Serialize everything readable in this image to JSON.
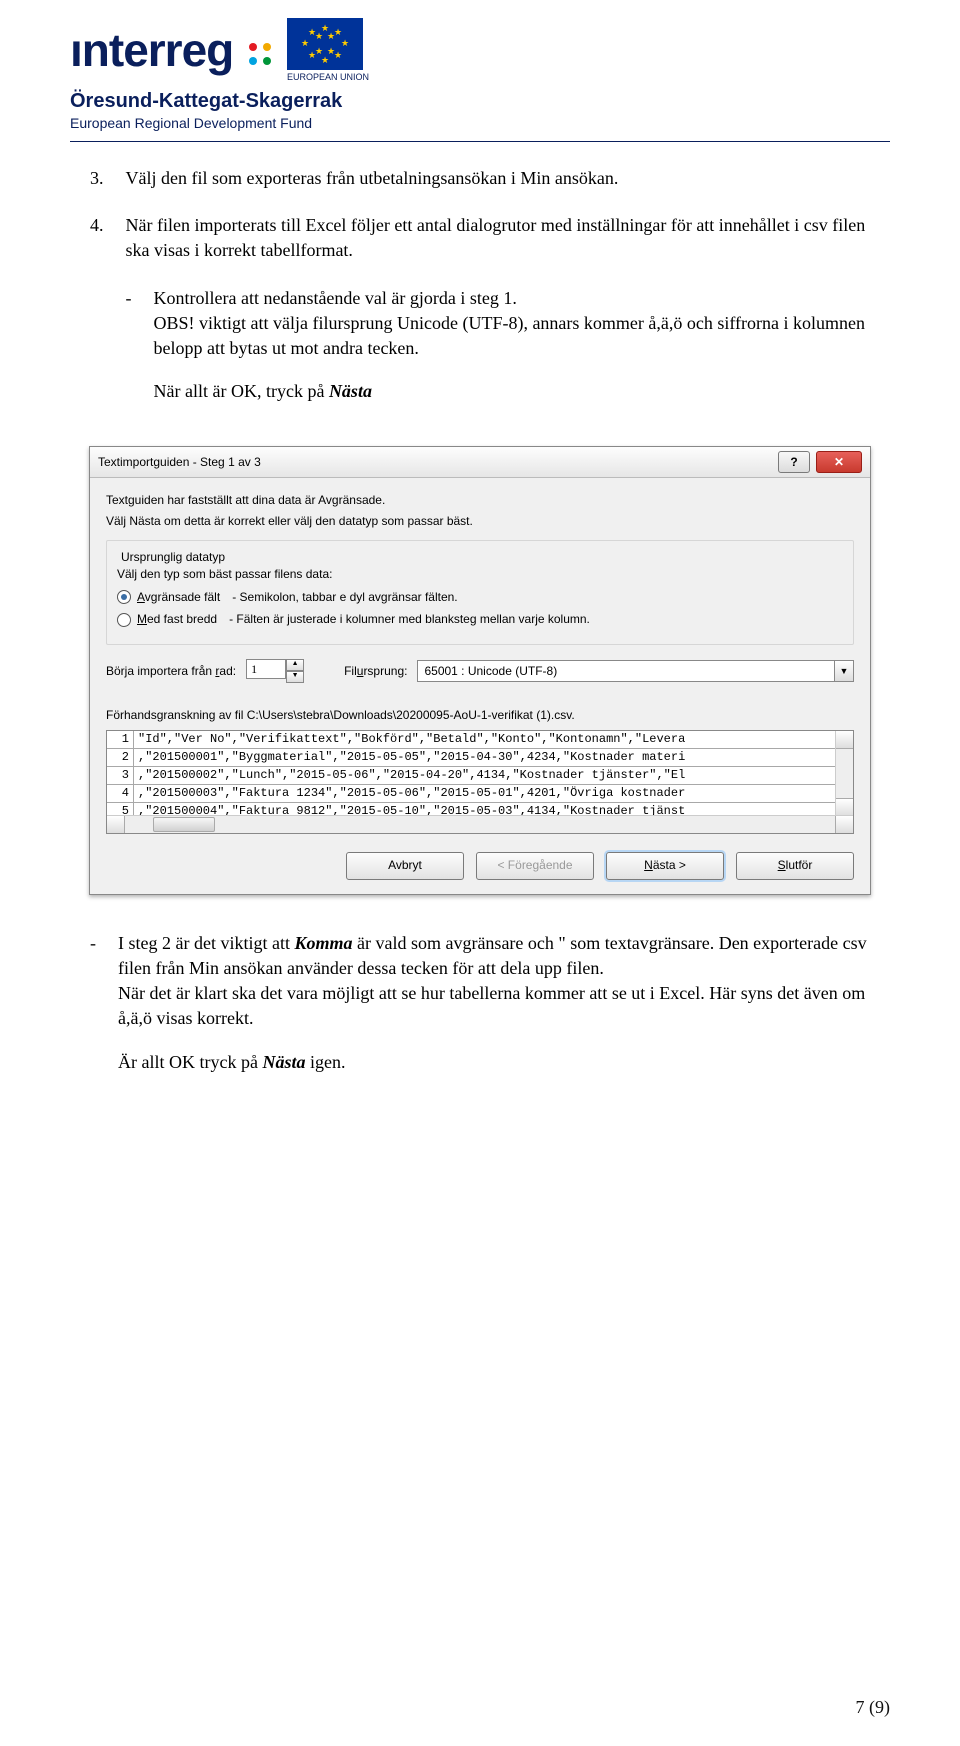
{
  "header": {
    "logo_text": "Interreg",
    "eu_caption": "EUROPEAN UNION",
    "subtitle1": "Öresund-Kattegat-Skagerrak",
    "subtitle2": "European Regional Development Fund"
  },
  "list": {
    "item3": {
      "num": "3.",
      "text": "Välj den fil som exporteras från utbetalningsansökan i Min ansökan."
    },
    "item4": {
      "num": "4.",
      "text": "När filen importerats till Excel följer ett antal dialogrutor med inställningar för att innehållet i csv filen ska visas i korrekt tabellformat."
    },
    "sub1": {
      "dash": "-",
      "text_a": "Kontrollera att nedanstående val är gjorda i steg 1.",
      "text_b": "OBS! viktigt att välja filursprung Unicode (UTF-8), annars kommer å,ä,ö och siffrorna i kolumnen belopp att bytas ut mot andra tecken.",
      "text_c_pre": "När allt är OK, tryck på ",
      "text_c_em": "Nästa"
    }
  },
  "dialog": {
    "title": "Textimportguiden - Steg 1 av 3",
    "line1": "Textguiden har fastställt att dina data är Avgränsade.",
    "line2": "Välj Nästa om detta är korrekt eller välj den datatyp som passar bäst.",
    "group_title": "Ursprunglig datatyp",
    "prompt": "Välj den typ som bäst passar filens data:",
    "radio1_label": "Avgränsade fält",
    "radio1_desc": "- Semikolon, tabbar e dyl avgränsar fälten.",
    "radio2_label": "Med fast bredd",
    "radio2_desc": "- Fälten är justerade i kolumner med blanksteg mellan varje kolumn.",
    "start_row_label": "Börja importera från rad:",
    "start_row_value": "1",
    "origin_label": "Filursprung:",
    "origin_value": "65001 : Unicode (UTF-8)",
    "preview_label": "Förhandsgranskning av fil C:\\Users\\stebra\\Downloads\\20200095-AoU-1-verifikat (1).csv.",
    "preview_rows": [
      {
        "n": "1",
        "t": "\"Id\",\"Ver No\",\"Verifikattext\",\"Bokförd\",\"Betald\",\"Konto\",\"Kontonamn\",\"Levera"
      },
      {
        "n": "2",
        "t": ",\"201500001\",\"Byggmaterial\",\"2015-05-05\",\"2015-04-30\",4234,\"Kostnader materi"
      },
      {
        "n": "3",
        "t": ",\"201500002\",\"Lunch\",\"2015-05-06\",\"2015-04-20\",4134,\"Kostnader tjänster\",\"El"
      },
      {
        "n": "4",
        "t": ",\"201500003\",\"Faktura 1234\",\"2015-05-06\",\"2015-05-01\",4201,\"Övriga kostnader"
      },
      {
        "n": "5",
        "t": ",\"201500004\",\"Faktura 9812\",\"2015-05-10\",\"2015-05-03\",4134,\"Kostnader tjänst"
      }
    ],
    "buttons": {
      "cancel": "Avbryt",
      "back": "< Föregående",
      "next": "Nästa >",
      "finish": "Slutför"
    }
  },
  "step2": {
    "dash": "-",
    "seg_a": "I steg 2 är det viktigt att ",
    "seg_em": "Komma",
    "seg_b": " är vald som avgränsare och \" som textavgränsare. Den exporterade csv filen från Min ansökan använder dessa tecken för att dela upp filen.",
    "line2": "När det är klart ska det vara möjligt att se hur tabellerna kommer att se ut i Excel. Här syns det även om å,ä,ö visas korrekt.",
    "line3_a": "Är allt OK tryck på ",
    "line3_em": "Nästa",
    "line3_b": " igen."
  },
  "footer": {
    "page": "7 (9)"
  },
  "chart_data": {
    "type": "table",
    "columns": [
      "Id",
      "Ver No",
      "Verifikattext",
      "Bokförd",
      "Betald",
      "Konto",
      "Kontonamn"
    ],
    "rows": [
      [
        "",
        "201500001",
        "Byggmaterial",
        "2015-05-05",
        "2015-04-30",
        4234,
        "Kostnader materi…"
      ],
      [
        "",
        "201500002",
        "Lunch",
        "2015-05-06",
        "2015-04-20",
        4134,
        "Kostnader tjänster"
      ],
      [
        "",
        "201500003",
        "Faktura 1234",
        "2015-05-06",
        "2015-05-01",
        4201,
        "Övriga kostnader"
      ],
      [
        "",
        "201500004",
        "Faktura 9812",
        "2015-05-10",
        "2015-05-03",
        4134,
        "Kostnader tjänst…"
      ]
    ],
    "title": "Förhandsgranskning av fil C:\\Users\\stebra\\Downloads\\20200095-AoU-1-verifikat (1).csv."
  }
}
